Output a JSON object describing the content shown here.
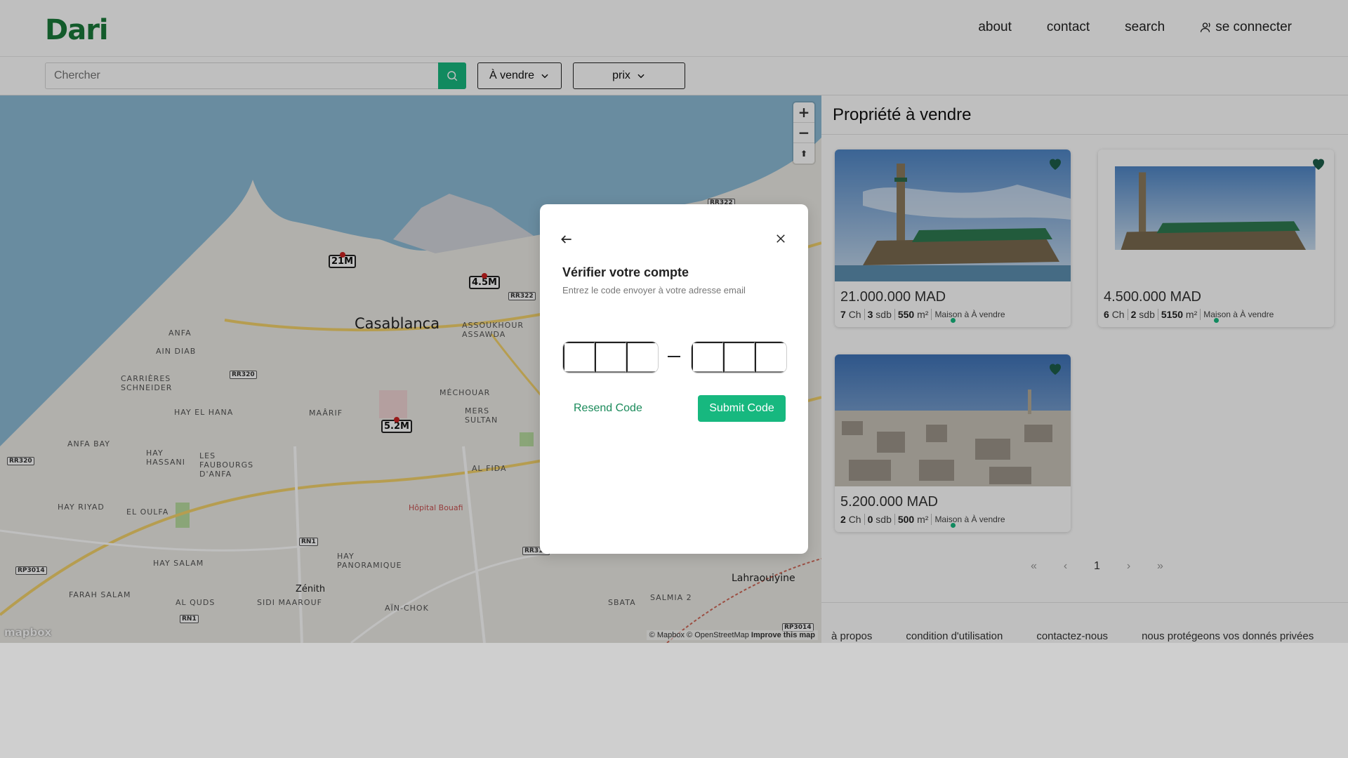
{
  "header": {
    "logo": "Dari",
    "nav": [
      {
        "label": "about"
      },
      {
        "label": "contact"
      },
      {
        "label": "search"
      },
      {
        "label": "se connecter",
        "icon": "user-icon"
      }
    ]
  },
  "searchbar": {
    "placeholder": "Chercher",
    "button_icon": "search-icon",
    "filters": [
      {
        "label": "À vendre",
        "icon": "chevron-down-icon"
      },
      {
        "label": "prix",
        "icon": "chevron-down-icon"
      }
    ]
  },
  "map": {
    "controls": {
      "zoom_in": "+",
      "zoom_out": "−",
      "reset": "⬆"
    },
    "city": "Casablanca",
    "districts": [
      "ANFA",
      "AIN DIAB",
      "CARRIÈRES SCHNEIDER",
      "HAY EL HANA",
      "MAÂRIF",
      "ANFA BAY",
      "HAY HASSANI",
      "LES FAUBOURGS D'ANFA",
      "MÉCHOUAR",
      "MERS SULTAN",
      "AL FIDA",
      "ASSOUKHOUR ASSAWDA",
      "HAY RIYAD",
      "EL OULFA",
      "HAY SALAM",
      "HAY PANORAMIQUE",
      "FARAH SALAM",
      "AL QUDS",
      "SIDI MAAROUF",
      "AÏN-CHOK",
      "SBATA",
      "SALMIA 2"
    ],
    "places": [
      "Zénith",
      "Lahraouiyine",
      "Hôpital Bouafi"
    ],
    "roads": [
      "RR320",
      "RR320",
      "RP3014",
      "RR322",
      "RN1",
      "RN1",
      "RR315",
      "RR322",
      "RP3014"
    ],
    "price_pins": [
      "21M",
      "4.5M",
      "5.2M"
    ],
    "attribution": {
      "mapbox": "© Mapbox",
      "osm": "© OpenStreetMap",
      "improve": "Improve this map"
    },
    "logo": "mapbox"
  },
  "listing": {
    "title": "Propriété à vendre",
    "cards": [
      {
        "price": "21.000.000 MAD",
        "bedrooms": "7",
        "bedrooms_unit": "Ch",
        "bathrooms": "3",
        "bathrooms_unit": "sdb",
        "area": "550",
        "area_unit": "m²",
        "type": "Maison à À vendre",
        "favorite": true
      },
      {
        "price": "4.500.000 MAD",
        "bedrooms": "6",
        "bedrooms_unit": "Ch",
        "bathrooms": "2",
        "bathrooms_unit": "sdb",
        "area": "5150",
        "area_unit": "m²",
        "type": "Maison à À vendre",
        "favorite": true
      },
      {
        "price": "5.200.000 MAD",
        "bedrooms": "2",
        "bedrooms_unit": "Ch",
        "bathrooms": "0",
        "bathrooms_unit": "sdb",
        "area": "500",
        "area_unit": "m²",
        "type": "Maison à À vendre",
        "favorite": true
      }
    ],
    "pagination": {
      "first": "«",
      "prev": "‹",
      "current": "1",
      "next": "›",
      "last": "»"
    }
  },
  "footer": {
    "links": [
      "à propos",
      "condition d'utilisation",
      "contactez-nous",
      "nous protégeons vos donnés privées"
    ]
  },
  "modal": {
    "title": "Vérifier votre compte",
    "subtitle": "Entrez le code envoyer à votre adresse email",
    "resend": "Resend Code",
    "submit": "Submit Code",
    "code_separator": "–"
  },
  "colors": {
    "brand": "#1a7a3a",
    "accent": "#17b87f",
    "heart": "#1d5e4a"
  }
}
